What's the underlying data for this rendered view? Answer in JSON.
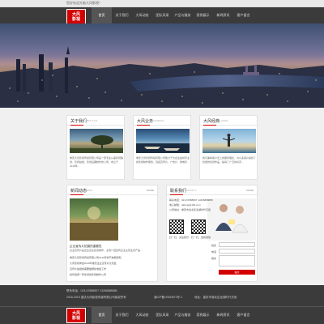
{
  "topbar": {
    "welcome": "您好欢迎光临大风影视！"
  },
  "logo": {
    "line1": "大风",
    "line2": "影视"
  },
  "nav": [
    "首页",
    "关于我们",
    "大风动态",
    "团队风采",
    "产品与服务",
    "案例展示",
    "新闻资讯",
    "客户留言"
  ],
  "about": {
    "title": "关于我们",
    "en": "ABOUT US",
    "more": "",
    "text": "重庆大风影视传媒有限公司是一家专业从事影视策划、影视拍摄、影视后期制作的公司，成立于2018年..."
  },
  "business": {
    "title": "大风业务",
    "en": "BUSINESS",
    "text": "重庆大风影视传媒有限公司致力于为企业提供专业的影视制作服务，包括宣传片、广告片、微电影..."
  },
  "culture": {
    "title": "大风经典",
    "en": "CLASSIC",
    "text": "我们秉承客户至上的服务理念，为众多客户提供了优质的影视作品，赢得了广泛的好评..."
  },
  "news": {
    "title": "新闻动态",
    "en": "NEWS",
    "more": "MORE",
    "headline": "企业宣传片拍摄的重要性",
    "headline_text": "企业宣传片是企业自主投资制作，主观介绍自有企业主营业务产品...",
    "items": [
      "重庆大风影视传媒有限公司2019年春节放假通知",
      "大风影视参加2019年重庆企业宣传片交流会",
      "宣传片拍摄前需要做哪些准备工作",
      "如何选择一家靠谱的影视制作公司",
      "微电影的营销价值有哪些"
    ]
  },
  "contact": {
    "title": "联系我们",
    "en": "CONTACT",
    "more": "MORE",
    "phone": "联系电话：023-67888897 13266888888",
    "email": "电子邮箱：dafeng@163.com",
    "address": "公司地址：重庆市渝北区龙湖时代天街",
    "qr1": "扫一扫，关注我们",
    "qr2": "扫一扫，加我微信",
    "form_name": "姓名",
    "form_phone": "电话",
    "form_msg": "留言",
    "submit": "提交"
  },
  "footer": {
    "phone": "联系电话：023-67888897 13266888888",
    "copyright": "2016-2019 重庆大风影视传媒有限公司版权所有",
    "icp": "渝ICP备19000871号-1",
    "address": "地址：重庆市渝北区龙湖时代天街"
  },
  "colors": {
    "header": "#3b3b3b",
    "accent": "#d40000",
    "bg": "#f0f0f0"
  }
}
